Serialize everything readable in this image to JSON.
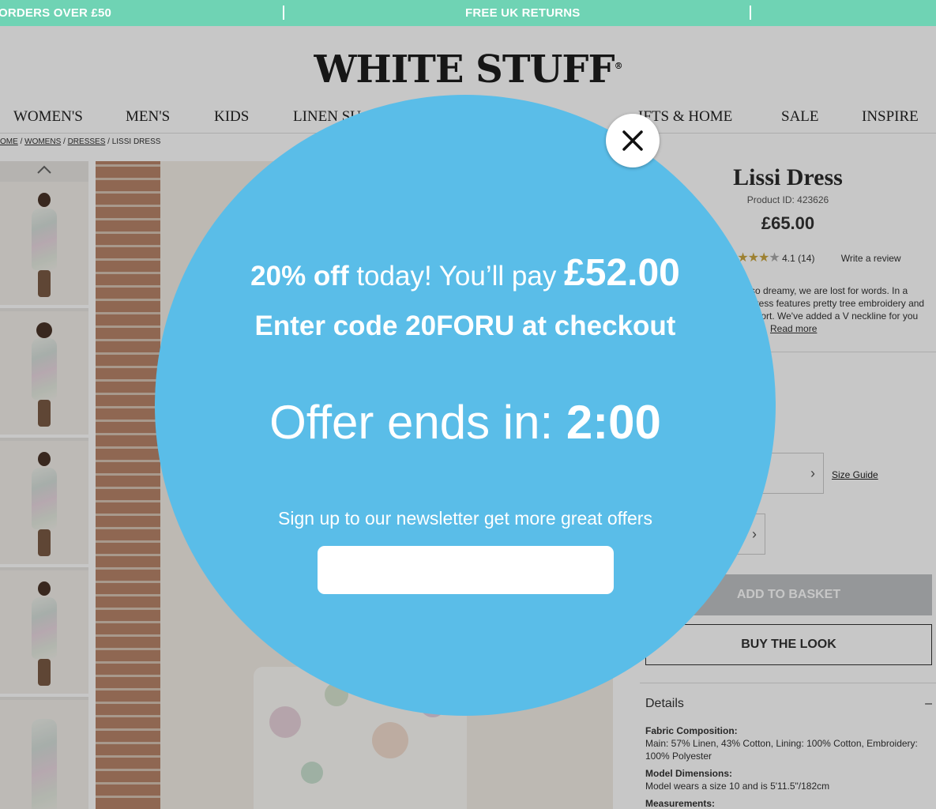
{
  "promo": {
    "left_text": "ORDERS OVER £50",
    "center_text": "FREE UK RETURNS"
  },
  "brand": {
    "logo_text": "WHITE STUFF",
    "reg_mark": "®"
  },
  "nav": {
    "items": [
      {
        "label": "WOMEN'S"
      },
      {
        "label": "MEN'S"
      },
      {
        "label": "KIDS"
      },
      {
        "label": "LINEN SU"
      },
      {
        "label": "IFTS & HOME"
      },
      {
        "label": "SALE"
      },
      {
        "label": "INSPIRE"
      }
    ]
  },
  "breadcrumb": {
    "home": "OME",
    "womens": "WOMENS",
    "dresses": "DRESSES",
    "current": "LISSI DRESS",
    "sep": "/"
  },
  "gallery": {
    "up_arrow": "^"
  },
  "product": {
    "name": "Lissi Dress",
    "product_id": "Product ID: 423626",
    "price": "£65.00",
    "rating_value": "4.1",
    "review_count": "(14)",
    "write_review": "Write a review",
    "desc_line1": "so dreamy, we are lost for words. In a",
    "desc_line2": "dress features pretty tree embroidery and",
    "desc_line3": "mfort. We've added a V neckline for you",
    "read_more": "Read more",
    "size_guide": "Size Guide",
    "add_to_basket": "ADD TO BASKET",
    "buy_the_look": "BUY THE LOOK",
    "details_title": "Details",
    "details_toggle": "–",
    "fabric_label": "Fabric Composition:",
    "fabric_value": "Main: 57% Linen, 43% Cotton, Lining: 100% Cotton, Embroidery: 100% Polyester",
    "model_label": "Model Dimensions:",
    "model_value": "Model wears a size 10 and is 5'11.5\"/182cm",
    "measurements_label": "Measurements:"
  },
  "modal": {
    "discount_bold": "20% off",
    "discount_text": " today! You’ll pay ",
    "final_price": "£52.00",
    "code_text": "Enter code 20FORU at checkout",
    "offer_prefix": "Offer ends in: ",
    "countdown": "2:00",
    "newsletter_text": "Sign up to our newsletter get more great offers",
    "email_value": ""
  },
  "colors": {
    "promo_bar": "#6fd3b4",
    "modal_circle": "#5abde8",
    "add_button": "#bfc2c4"
  },
  "icons": {
    "close": "close-icon",
    "chevron": "chevron-right-icon",
    "star": "star-icon"
  }
}
